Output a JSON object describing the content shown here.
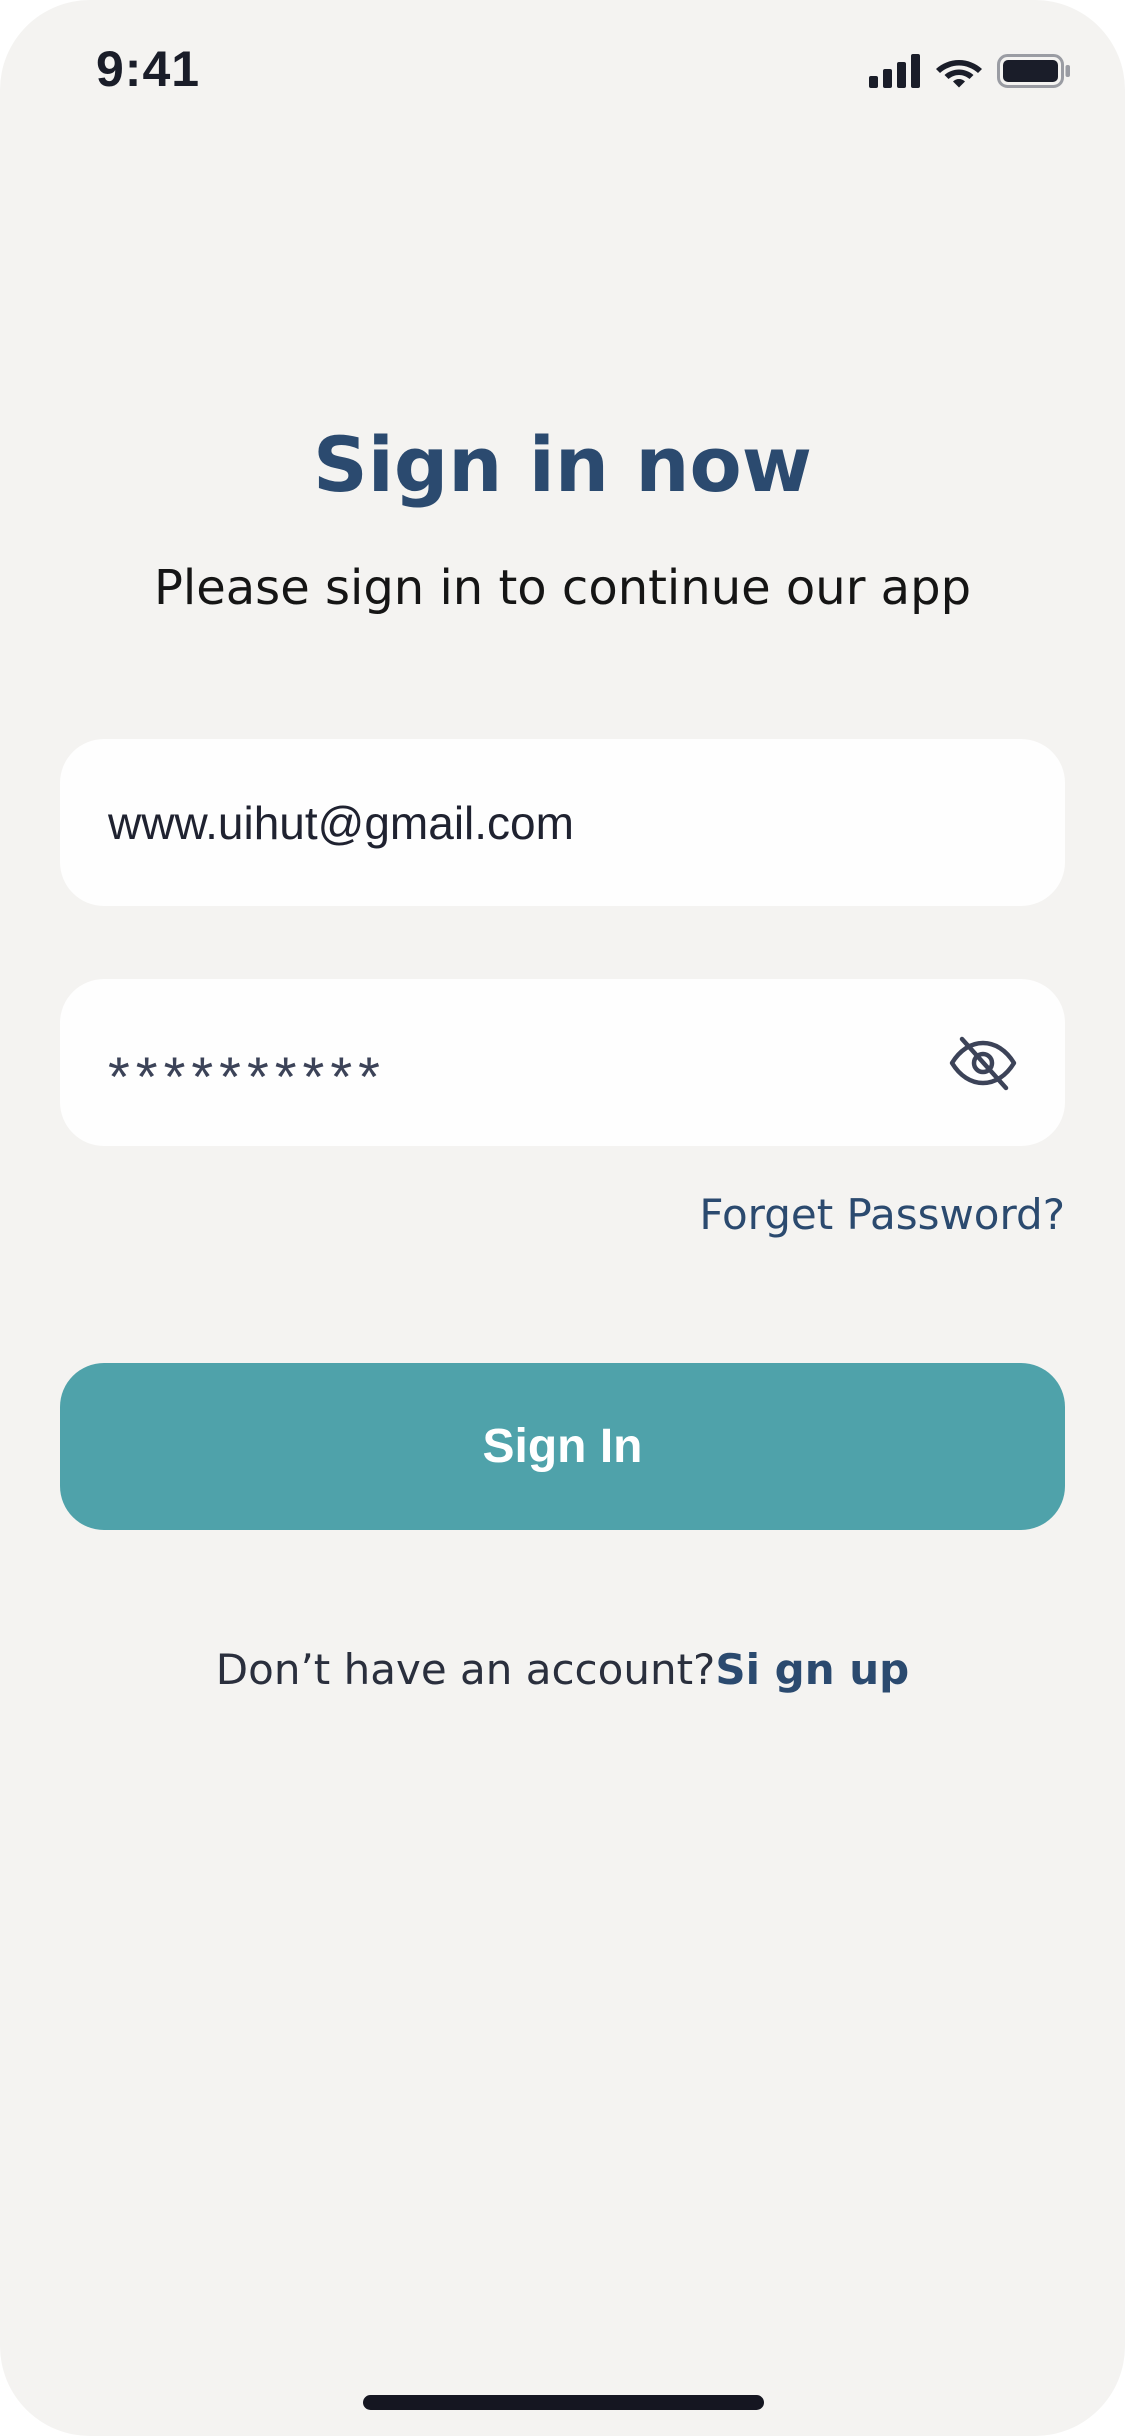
{
  "status_bar": {
    "time": "9:41",
    "icons": [
      "cellular-signal-icon",
      "wifi-icon",
      "battery-icon"
    ]
  },
  "header": {
    "title": "Sign in now",
    "subtitle": "Please sign in to continue our app"
  },
  "form": {
    "email_value": "www.uihut@gmail.com",
    "password_masked": "**********",
    "password_toggle_icon": "eye-off-icon",
    "forgot_label": "Forget Password?",
    "submit_label": "Sign In"
  },
  "footer": {
    "prompt": "Don’t have an account?",
    "signup_label": "Si gn up"
  },
  "colors": {
    "background": "#f4f3f1",
    "accent": "#4fa2aa",
    "title": "#2b4a6f",
    "field": "#fefefe"
  }
}
